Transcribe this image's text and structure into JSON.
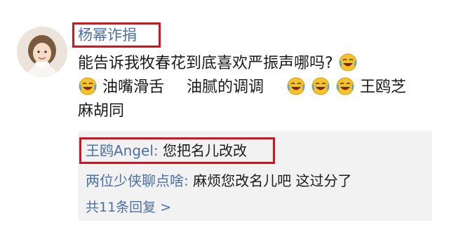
{
  "comment": {
    "avatar_icon": "user-avatar",
    "username": "杨幂诈捐",
    "line1_text": "能告诉我牧春花到底喜欢严振声哪吗?",
    "line2_part1": "油嘴滑舌",
    "line2_part2": "油腻的调调",
    "line2_part3": "王鸥芝",
    "line3_text": "麻胡同",
    "emoji_icon": "laughing-crying-emoji"
  },
  "replies": [
    {
      "author": "王鸥Angel:",
      "text": "您把名儿改改"
    },
    {
      "author": "两位少侠聊点啥:",
      "text": "麻烦您改名儿吧 这过分了"
    }
  ],
  "more_replies": "共11条回复 >",
  "colors": {
    "link_blue": "#4a6fa5",
    "highlight_red": "#d2141e",
    "reply_bg": "#f2f2f2",
    "text": "#1a1a1a"
  }
}
